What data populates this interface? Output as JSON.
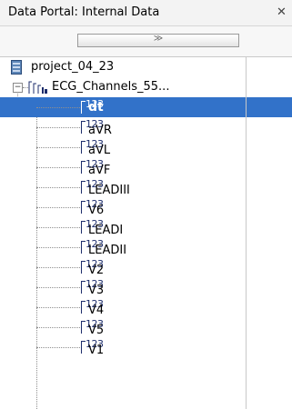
{
  "window": {
    "title": "Data Portal: Internal Data",
    "close_glyph": "✕"
  },
  "toolbar": {
    "expand_glyph": "≫"
  },
  "tree": {
    "project": {
      "label": "project_04_23",
      "icon": "project-icon"
    },
    "group": {
      "label": "ECG_Channels_55...",
      "icon": "channel-group-icon",
      "expander": "−"
    },
    "channel_icon_text": "123",
    "selected_channel": "dt",
    "channels": [
      {
        "label": "dt",
        "selected": true
      },
      {
        "label": "aVR"
      },
      {
        "label": "aVL"
      },
      {
        "label": "aVF"
      },
      {
        "label": "LEADIII"
      },
      {
        "label": "V6"
      },
      {
        "label": "LEADI"
      },
      {
        "label": "LEADII"
      },
      {
        "label": "V2"
      },
      {
        "label": "V3"
      },
      {
        "label": "V4"
      },
      {
        "label": "V5"
      },
      {
        "label": "V1"
      }
    ]
  },
  "colors": {
    "selection": "#3272c9",
    "icon_blue": "#1d2d6b"
  }
}
